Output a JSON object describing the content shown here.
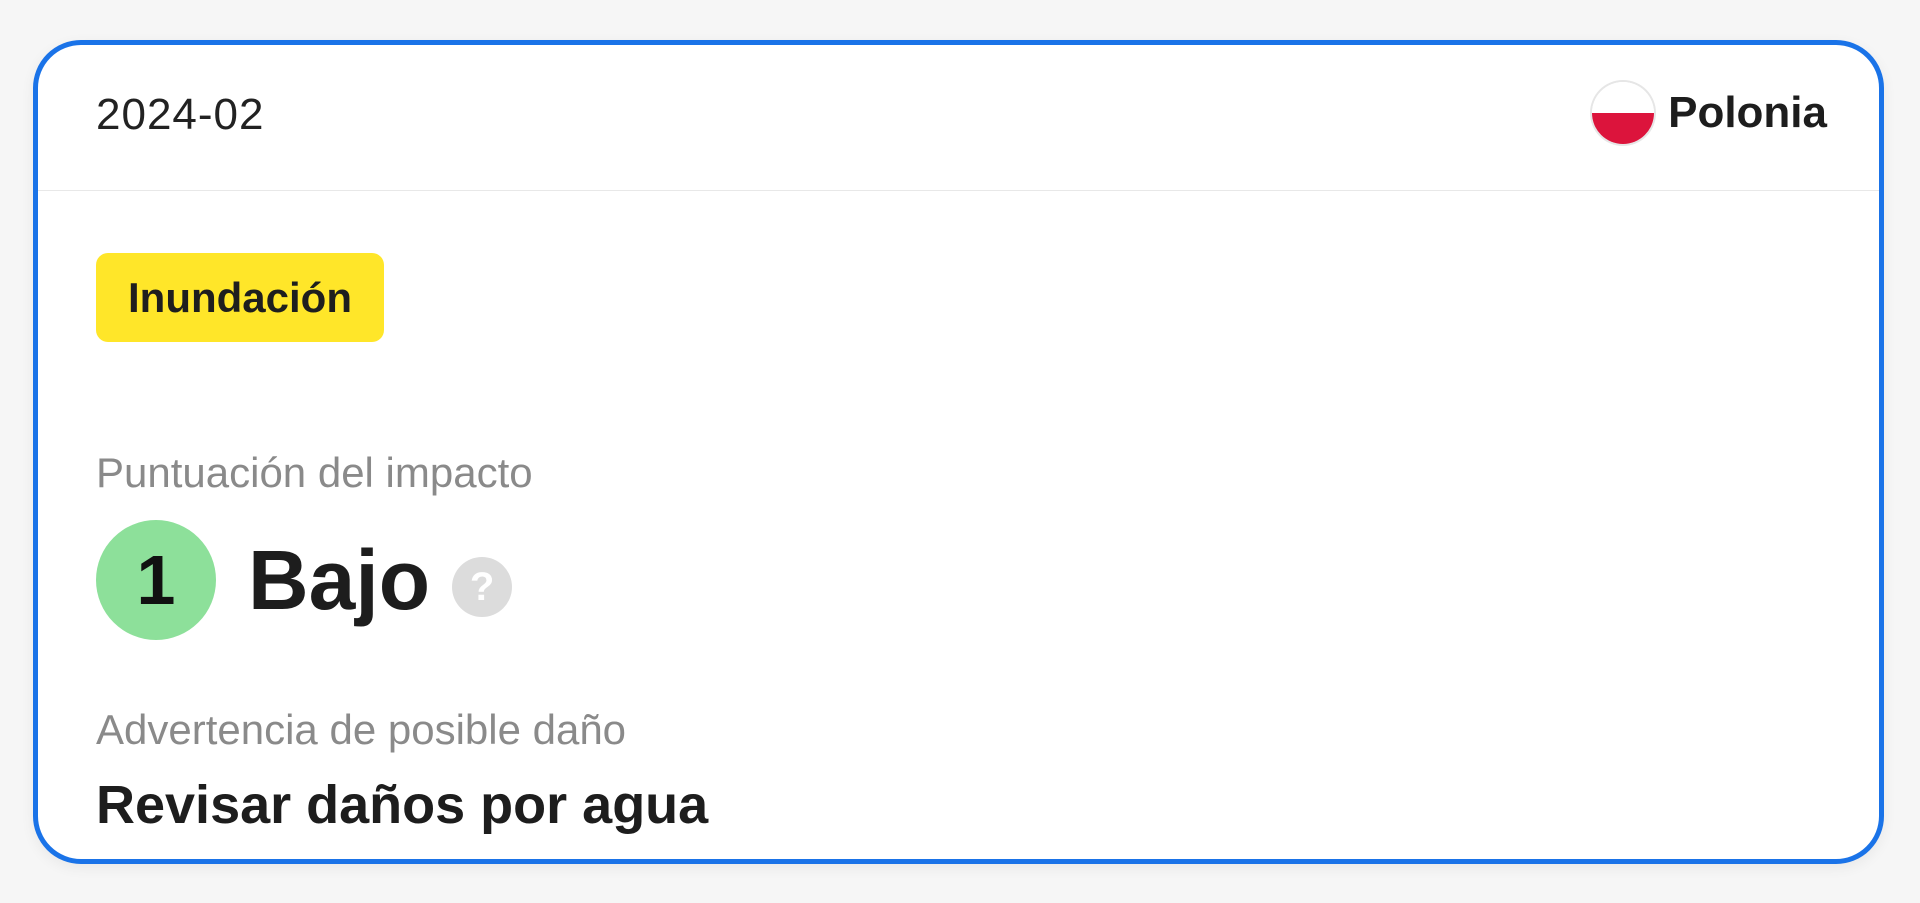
{
  "header": {
    "date": "2024-02",
    "country": "Polonia",
    "flag_icon": "poland-flag-icon",
    "flag_colors": [
      "#ffffff",
      "#dc143c"
    ]
  },
  "event": {
    "type_badge": "Inundación",
    "badge_color": "#ffe629"
  },
  "impact": {
    "label": "Puntuación del impacto",
    "score": "1",
    "level": "Bajo",
    "score_color": "#8de09a",
    "help_symbol": "?"
  },
  "warning": {
    "label": "Advertencia de posible daño",
    "text": "Revisar daños por agua"
  },
  "accent_color": "#1a73e8"
}
